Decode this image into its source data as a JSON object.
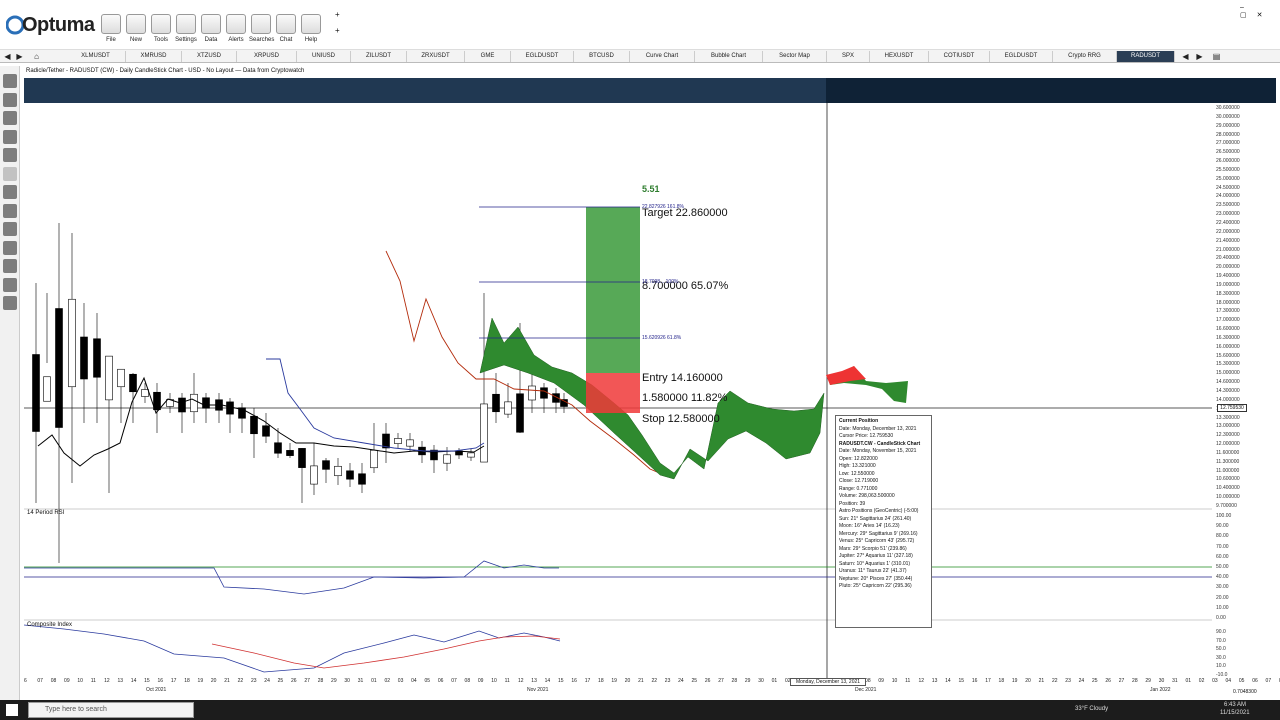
{
  "toolbar": {
    "logo": "Optuma",
    "buttons": [
      {
        "label": "File",
        "icon": "folder-icon"
      },
      {
        "label": "New",
        "icon": "new-doc-icon"
      },
      {
        "label": "Tools",
        "icon": "tools-icon"
      },
      {
        "label": "Settings",
        "icon": "gear-icon"
      },
      {
        "label": "Data",
        "icon": "data-icon"
      },
      {
        "label": "Alerts",
        "icon": "alert-clock-icon"
      },
      {
        "label": "Searches",
        "icon": "search-icon"
      },
      {
        "label": "Chat",
        "icon": "chat-icon"
      },
      {
        "label": "Help",
        "icon": "help-icon"
      }
    ]
  },
  "tabs": [
    "XLMUSDT",
    "XMRUSD",
    "XTZUSD",
    "XRPUSD",
    "UNIUSD",
    "ZILUSDT",
    "ZRXUSDT",
    "GME",
    "EGLDUSDT",
    "BTCUSD",
    "Curve Chart",
    "Bubble Chart",
    "Sector Map",
    "SPX",
    "HEXUSDT",
    "COTIUSDT",
    "EGLDUSDT",
    "Crypto RRG",
    "RADUSDT"
  ],
  "chart": {
    "title": "Radicle/Tether - RADUSDT (CW) - Daily CandleStick Chart - USD - No Layout — Data from Cryptowatch",
    "rsi_title": "14 Period RSI",
    "ci_title": "Composite Index",
    "pct_label": "5.51",
    "target_label": "Target  22.860000",
    "mid_label": "8.700000   65.07%",
    "entry_label": "Entry  14.160000",
    "risk_label": "1.580000   11.82%",
    "stop_label": "Stop  12.580000",
    "fib_top": "22.827926   161.8%",
    "fib_mid": "18.7098...   100%",
    "fib_low": "15.620926   61.8%",
    "current_price": "12.759530",
    "date_box": "Monday, December 13, 2021",
    "scale_value": "0.7048300"
  },
  "tooltip": {
    "h1": "Current Position",
    "date": "Date: Monday, December 13, 2021",
    "cursor": "Cursor Price: 12.759530",
    "h2": "RADUSDT.CW - CandleStick Chart",
    "bar_date": "Date: Monday, November 15, 2021",
    "open": "Open: 12.822000",
    "high": "High: 13.321000",
    "low": "Low: 12.550000",
    "close": "Close: 12.719000",
    "range": "Range: 0.771000",
    "volume": "Volume: 298,063.500000",
    "position": "Position: 39",
    "astro_h": "Astro Positions (GeoCentric) (-5:00)",
    "astro": [
      "Sun: 21° Sagittarius 24' (261.40)",
      "Moon: 16° Aries 14' (16.23)",
      "Mercury: 29° Sagittarius 9' (269.16)",
      "Venus: 25° Capricorn 43' (295.72)",
      "Mars: 29° Scorpio 51' (239.86)",
      "Jupiter: 27° Aquarius 11' (327.18)",
      "Saturn: 10° Aquarius 1' (310.01)",
      "Uranus: 11° Taurus 22' (41.37)",
      "Neptune: 20° Pisces 27' (350.44)",
      "Pluto: 25° Capricorn 22' (295.36)"
    ]
  },
  "y_axis_price": [
    "30.600000",
    "30.000000",
    "29.000000",
    "28.000000",
    "27.000000",
    "26.500000",
    "26.000000",
    "25.500000",
    "25.000000",
    "24.500000",
    "24.000000",
    "23.500000",
    "23.000000",
    "22.400000",
    "22.000000",
    "21.400000",
    "21.000000",
    "20.400000",
    "20.000000",
    "19.400000",
    "19.000000",
    "18.300000",
    "18.000000",
    "17.300000",
    "17.000000",
    "16.600000",
    "16.300000",
    "16.000000",
    "15.600000",
    "15.300000",
    "15.000000",
    "14.600000",
    "14.300000",
    "14.000000",
    "13.600000",
    "13.300000",
    "13.000000",
    "12.300000",
    "12.000000",
    "11.600000",
    "11.300000",
    "11.000000",
    "10.600000",
    "10.400000",
    "10.000000",
    "9.700000"
  ],
  "y_axis_rsi": [
    "100.00",
    "90.00",
    "80.00",
    "70.00",
    "60.00",
    "50.00",
    "40.00",
    "30.00",
    "20.00",
    "10.00",
    "0.00"
  ],
  "y_axis_ci": [
    "90.0",
    "70.0",
    "50.0",
    "30.0",
    "10.0",
    "-10.0"
  ],
  "x_days": [
    "6",
    "07",
    "08",
    "09",
    "10",
    "11",
    "12",
    "13",
    "14",
    "15",
    "16",
    "17",
    "18",
    "19",
    "20",
    "21",
    "22",
    "23",
    "24",
    "25",
    "26",
    "27",
    "28",
    "29",
    "30",
    "31",
    "01",
    "02",
    "03",
    "04",
    "05",
    "06",
    "07",
    "08",
    "09",
    "10",
    "11",
    "12",
    "13",
    "14",
    "15",
    "16",
    "17",
    "18",
    "19",
    "20",
    "21",
    "22",
    "23",
    "24",
    "25",
    "26",
    "27",
    "28",
    "29",
    "30",
    "01",
    "02",
    "03",
    "04",
    "05",
    "06",
    "07",
    "08",
    "09",
    "10",
    "11",
    "12",
    "13",
    "14",
    "15",
    "16",
    "17",
    "18",
    "19",
    "20",
    "21",
    "22",
    "23",
    "24",
    "25",
    "26",
    "27",
    "28",
    "29",
    "30",
    "31",
    "01",
    "02",
    "03",
    "04",
    "05",
    "06",
    "07",
    "08",
    "09",
    "10",
    "11",
    "12",
    "13",
    "14",
    "15",
    "16",
    "17",
    "18",
    "19",
    "20",
    "21",
    "22"
  ],
  "x_months": [
    "Oct 2021",
    "Nov 2021",
    "Dec 2021",
    "Jan 2022"
  ],
  "taskbar": {
    "search_placeholder": "Type here to search",
    "weather": "33°F  Cloudy",
    "time": "6:43 AM",
    "date": "11/15/2021"
  }
}
